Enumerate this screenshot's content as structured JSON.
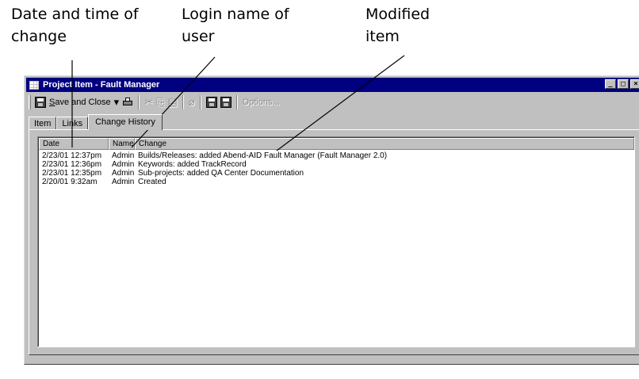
{
  "callouts": {
    "date": [
      "Date and time of",
      "change"
    ],
    "login": [
      "Login name of",
      "user"
    ],
    "modified": [
      "Modified",
      "item"
    ]
  },
  "window": {
    "title": "Project Item - Fault Manager",
    "controls": {
      "minimize": "_",
      "maximize": "□",
      "close": "×"
    }
  },
  "toolbar": {
    "save_close_label": "ave and Close",
    "save_close_accel": "S",
    "options_label": "Options..."
  },
  "tabs": [
    {
      "label": "Item",
      "active": false
    },
    {
      "label": "Links",
      "active": false
    },
    {
      "label": "Change History",
      "active": true
    }
  ],
  "list": {
    "columns": [
      "Date",
      "Name",
      "Change"
    ],
    "rows": [
      {
        "date": "2/23/01 12:37pm",
        "name": "Admin",
        "change": "Builds/Releases: added Abend-AID Fault Manager (Fault Manager 2.0)"
      },
      {
        "date": "2/23/01 12:36pm",
        "name": "Admin",
        "change": "Keywords: added TrackRecord"
      },
      {
        "date": "2/23/01 12:35pm",
        "name": "Admin",
        "change": "Sub-projects: added QA Center Documentation"
      },
      {
        "date": "2/20/01 9:32am",
        "name": "Admin",
        "change": "Created"
      }
    ]
  }
}
